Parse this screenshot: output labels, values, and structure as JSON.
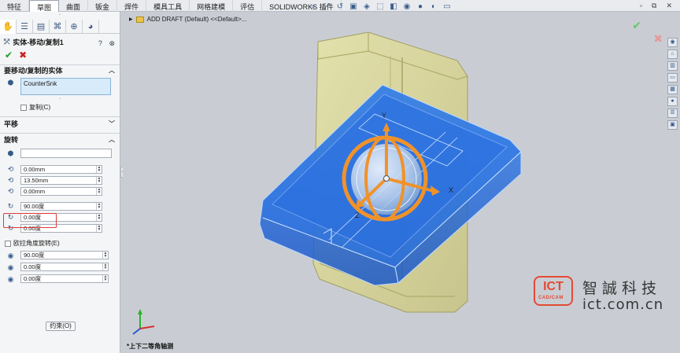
{
  "ribbon_tabs": [
    "特征",
    "草图",
    "曲面",
    "钣金",
    "焊件",
    "模具工具",
    "网格建模",
    "评估",
    "SOLIDWORKS 插件"
  ],
  "active_tab": "草图",
  "feature_tree": {
    "label": "ADD DRAFT  (Default) <<Default>..."
  },
  "property_manager": {
    "title": "实体-移动/复制1",
    "ok_symbol": "✔",
    "cancel_symbol": "✖",
    "help_symbol": "?",
    "bodies_section": {
      "header": "要移动/复制的实体",
      "selected_body": "CounterSnk",
      "copy_label": "复制(C)"
    },
    "translate_section": {
      "header": "平移"
    },
    "rotate_section": {
      "header": "旋转",
      "point_value": "",
      "x_value": "0.00mm",
      "y_value": "13.50mm",
      "z_value": "0.00mm",
      "angle_x": "90.00度",
      "angle_y": "0.00度",
      "angle_z": "0.00度",
      "euler_label": "欧拉角度旋转(E)",
      "euler_1": "90.00度",
      "euler_2": "0.00度",
      "euler_3": "0.00度"
    },
    "constraint_button": "约束(O)"
  },
  "view_orientation": "*上下二等角轴测",
  "triad_labels": {
    "x": "X",
    "y": "Y",
    "z": "Z"
  },
  "logo": {
    "mark": "ICT",
    "sub": "CAD/CAM",
    "chinese": "智誠科技",
    "web": "ict.com.cn"
  },
  "colors": {
    "accent_blue": "#1f6fe0",
    "yellow_part": "#d9d89a",
    "triad_orange": "#f0922a",
    "logo_red": "#e34a34"
  }
}
